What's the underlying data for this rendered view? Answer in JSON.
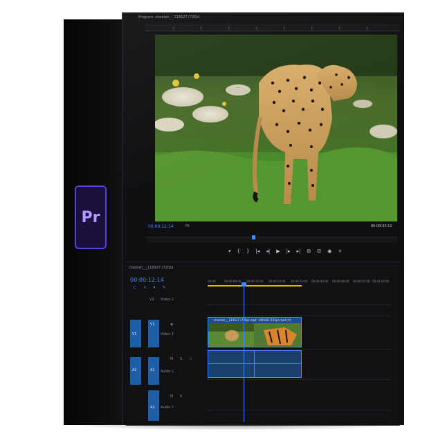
{
  "app": {
    "logo_text": "Pr"
  },
  "program_monitor": {
    "title": "Program: cheetah_-_119527 (720p)",
    "timecode_current": "00:00:12:14",
    "fit_label": "Fit",
    "timecode_duration": "00:00:33:11",
    "transport": {
      "marker": "▾",
      "in": "{",
      "out": "}",
      "go_to_in": "|◂",
      "step_back": "◂|",
      "play": "▶",
      "step_fwd": "|▸",
      "go_to_out": "▸|",
      "lift": "⊞",
      "extract": "⊟",
      "export_frame": "◉",
      "more": "+"
    }
  },
  "timeline": {
    "title": "cheetah_-_119527 (720p)",
    "timecode": "00:00:12:14",
    "ruler": [
      "00:00",
      "00:00:08:00",
      "00:00:16:00",
      "00:00:24:00",
      "00:00:32:00",
      "00:00:40:00",
      "00:00:48:00",
      "00:00:56:00",
      "00:01:04:00"
    ],
    "tracks": {
      "v2": {
        "label": "V2",
        "name": "Video 2"
      },
      "v1": {
        "label": "V1",
        "name": "Video 1",
        "target": "V1"
      },
      "a1": {
        "label": "A1",
        "name": "Audio 1",
        "target": "A1"
      },
      "a2": {
        "label": "A2",
        "name": "Audio 2"
      }
    },
    "clips": {
      "video_1": "cheetah_-_119527 (720p).mp4",
      "video_2": "149180 (720p).mp4 [V]"
    }
  }
}
